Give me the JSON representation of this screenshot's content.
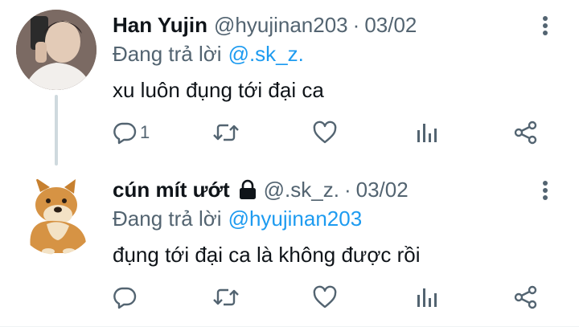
{
  "tweets": [
    {
      "display_name": "Han Yujin",
      "handle": "@hyujinan203",
      "separator": "·",
      "date": "03/02",
      "reply_prefix": "Đang trả lời",
      "reply_to": "@.sk_z.",
      "text": "xu luôn đụng tới đại ca",
      "reply_count": "1",
      "protected": false
    },
    {
      "display_name": "cún mít ướt",
      "handle": "@.sk_z.",
      "separator": "·",
      "date": "03/02",
      "reply_prefix": "Đang trả lời",
      "reply_to": "@hyujinan203",
      "text": "đụng tới đại ca là không được rồi",
      "reply_count": "",
      "protected": true
    }
  ],
  "colors": {
    "text": "#0f1419",
    "secondary": "#536471",
    "link": "#1d9bf0",
    "thread_line": "#cfd9de"
  },
  "icons": [
    "more-icon",
    "reply-icon",
    "retweet-icon",
    "like-icon",
    "stats-icon",
    "share-icon",
    "lock-icon"
  ]
}
